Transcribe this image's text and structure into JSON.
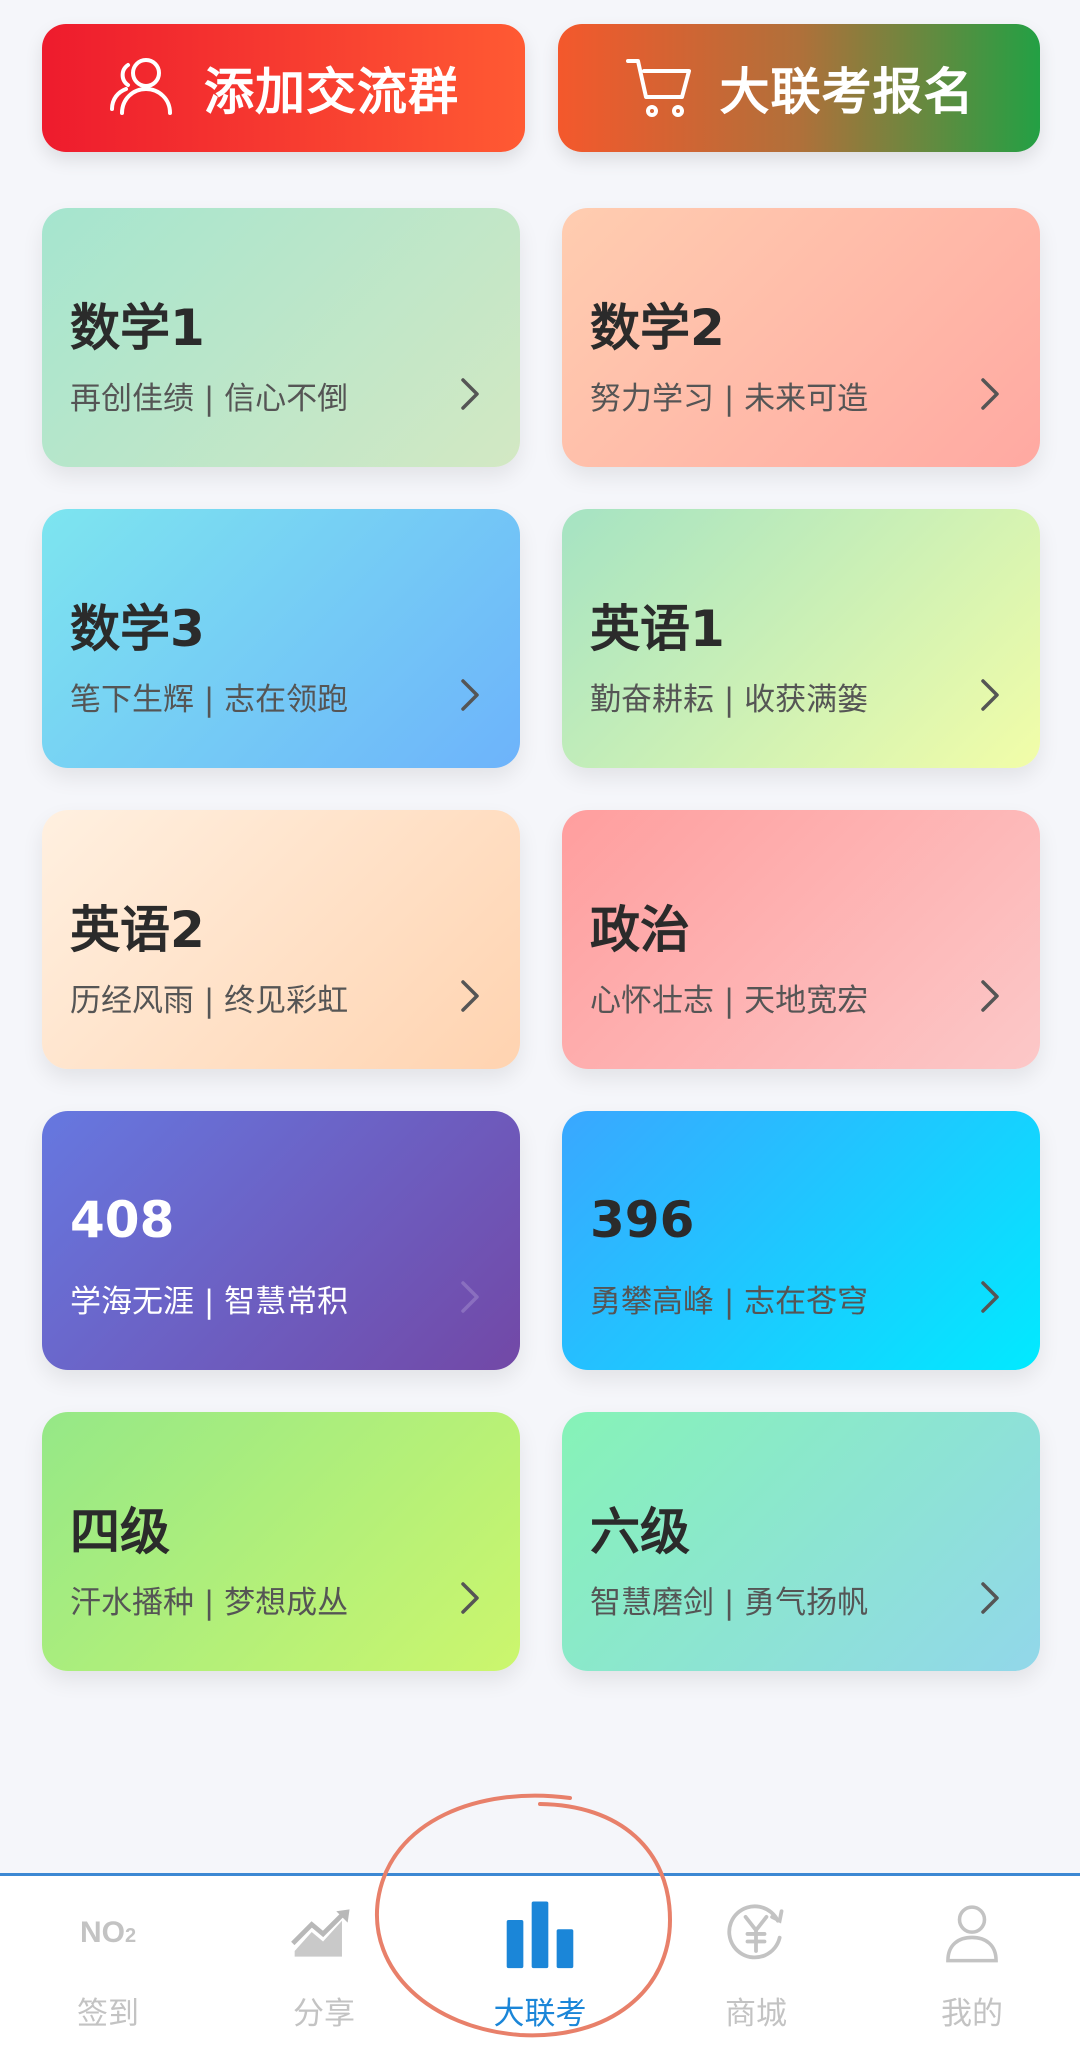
{
  "top_actions": {
    "join_group": "添加交流群",
    "exam_signup": "大联考报名"
  },
  "cards": [
    {
      "title": "数学1",
      "subtitle": "再创佳绩 | 信心不倒"
    },
    {
      "title": "数学2",
      "subtitle": "努力学习 | 未来可造"
    },
    {
      "title": "数学3",
      "subtitle": "笔下生辉 | 志在领跑"
    },
    {
      "title": "英语1",
      "subtitle": "勤奋耕耘 | 收获满篓"
    },
    {
      "title": "英语2",
      "subtitle": "历经风雨 | 终见彩虹"
    },
    {
      "title": "政治",
      "subtitle": "心怀壮志 | 天地宽宏"
    },
    {
      "title": "408",
      "subtitle": "学海无涯 | 智慧常积"
    },
    {
      "title": "396",
      "subtitle": "勇攀高峰 | 志在苍穹"
    },
    {
      "title": "四级",
      "subtitle": "汗水播种 | 梦想成丛"
    },
    {
      "title": "六级",
      "subtitle": "智慧磨剑 | 勇气扬帆"
    }
  ],
  "tabbar": {
    "checkin_icon_text": "NO",
    "checkin_icon_sub": "2",
    "items": [
      {
        "label": "签到",
        "icon": "no2-icon"
      },
      {
        "label": "分享",
        "icon": "chart-up-icon"
      },
      {
        "label": "大联考",
        "icon": "bar-chart-icon",
        "active": true
      },
      {
        "label": "商城",
        "icon": "yen-coin-icon"
      },
      {
        "label": "我的",
        "icon": "user-icon"
      }
    ]
  },
  "colors": {
    "active_tab": "#1b86d8",
    "inactive_tab": "#c3c3c3",
    "annotation": "#e8806a"
  }
}
